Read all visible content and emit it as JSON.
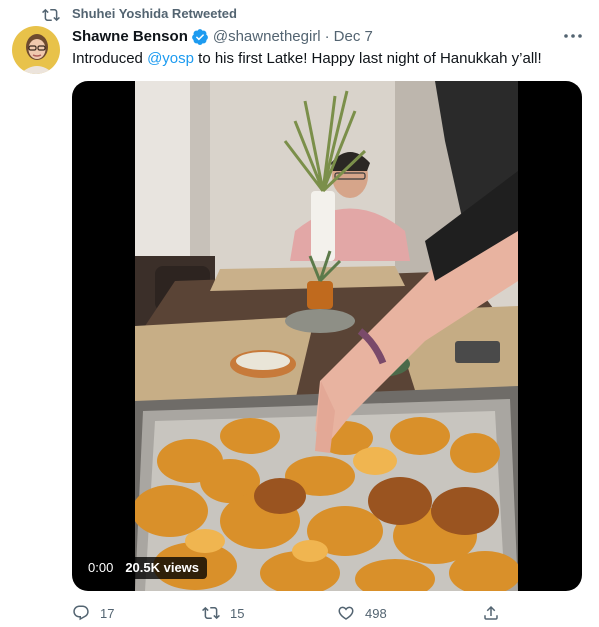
{
  "retweet": {
    "text": "Shuhei Yoshida Retweeted",
    "icon": "retweet-icon"
  },
  "tweet": {
    "author_name": "Shawne Benson",
    "verified": true,
    "handle": "@shawnethegirl",
    "separator": "·",
    "date": "Dec 7",
    "text_before": "Introduced ",
    "mention": "@yosp",
    "text_after": " to his first Latke! Happy last night of Hanukkah y’all!"
  },
  "media": {
    "type": "video",
    "time": "0:00",
    "views": "20.5K views"
  },
  "actions": {
    "reply_count": "17",
    "retweet_count": "15",
    "like_count": "498"
  },
  "colors": {
    "accent": "#1d9bf0",
    "secondary_text": "#536471",
    "primary_text": "#0f1419",
    "verified": "#1d9bf0"
  }
}
